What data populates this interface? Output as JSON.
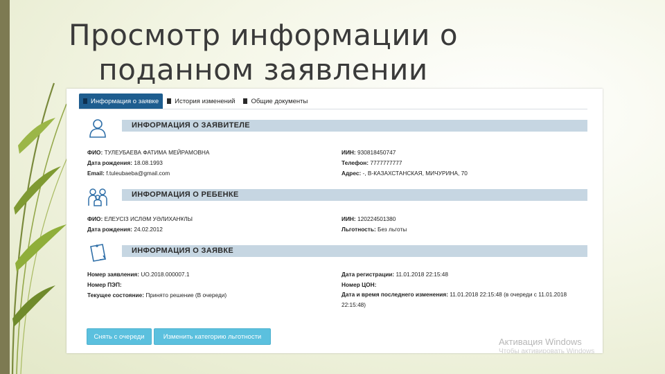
{
  "slide": {
    "title_line1": "Просмотр информации о",
    "title_line2": "поданном заявлении"
  },
  "tabs": [
    {
      "label": "Информация о заявке",
      "active": true
    },
    {
      "label": "История изменений",
      "active": false
    },
    {
      "label": "Общие документы",
      "active": false
    }
  ],
  "applicant": {
    "header": "ИНФОРМАЦИЯ О ЗАЯВИТЕЛЕ",
    "fio_label": "ФИО:",
    "fio": "ТУЛЕУБАЕВА ФАТИМА МЕЙРАМОВНА",
    "dob_label": "Дата рождения:",
    "dob": "18.08.1993",
    "email_label": "Email:",
    "email": "f.tuleubaeba@gmail.com",
    "iin_label": "ИИН:",
    "iin": "930818450747",
    "phone_label": "Телефон:",
    "phone": "7777777777",
    "address_label": "Адрес:",
    "address": "-, В-КАЗАХСТАНСКАЯ, МИЧУРИНА, 70"
  },
  "child": {
    "header": "ИНФОРМАЦИЯ О РЕБЕНКЕ",
    "fio_label": "ФИО:",
    "fio": "ЕЛЕУСІЗ ИСЛӘМ УӘЛИХАНҰЛЫ",
    "dob_label": "Дата рождения:",
    "dob": "24.02.2012",
    "iin_label": "ИИН:",
    "iin": "120224501380",
    "benefit_label": "Льготность:",
    "benefit": "Без льготы"
  },
  "application": {
    "header": "ИНФОРМАЦИЯ О ЗАЯВКЕ",
    "number_label": "Номер заявления:",
    "number": "UO.2018.000007.1",
    "pep_label": "Номер ПЭП:",
    "pep": "",
    "status_label": "Текущее состояние:",
    "status": "Принято решение (В очереди)",
    "reg_date_label": "Дата регистрации:",
    "reg_date": "11.01.2018 22:15:48",
    "con_label": "Номер ЦОН:",
    "con": "",
    "last_change_label": "Дата и время последнего изменения:",
    "last_change": "11.01.2018 22:15:48 (в очереди с 11.01.2018 22:15:48)"
  },
  "buttons": {
    "dequeue": "Снять с очереди",
    "change_benefit": "Изменить категорию льготности"
  },
  "watermark": {
    "line1": "Активация Windows",
    "line2": "Чтобы активировать Windows"
  },
  "colors": {
    "tab_active": "#1e5d8f",
    "section_header": "#c6d6e2",
    "button": "#5bc0de",
    "icon": "#2f6fa8"
  }
}
